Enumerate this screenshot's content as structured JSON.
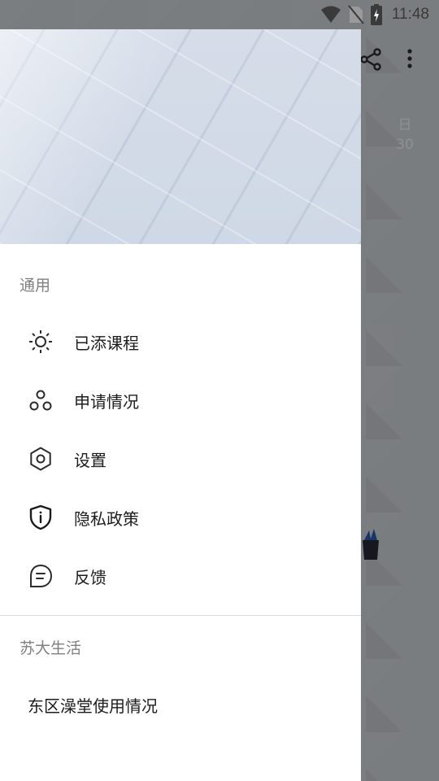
{
  "status_bar": {
    "time": "11:48",
    "icons": [
      "wifi-icon",
      "no-sim-icon",
      "battery-charging-icon"
    ]
  },
  "background_app": {
    "weekday_label": "日",
    "date_label": "30",
    "icons": [
      "share-icon",
      "more-vert-icon"
    ]
  },
  "drawer": {
    "sections": [
      {
        "title": "通用",
        "items": [
          {
            "label": "已添课程",
            "icon": "sun-icon"
          },
          {
            "label": "申请情况",
            "icon": "group-circles-icon"
          },
          {
            "label": "设置",
            "icon": "gear-icon"
          },
          {
            "label": "隐私政策",
            "icon": "shield-info-icon"
          },
          {
            "label": "反馈",
            "icon": "feedback-chat-icon"
          }
        ]
      },
      {
        "title": "苏大生活",
        "items": [
          {
            "label": "东区澡堂使用情况"
          }
        ]
      }
    ]
  },
  "colors": {
    "drawer_background": "#ffffff",
    "section_title": "#808080",
    "item_text": "#1c1c1c",
    "icon": "#2b2b2b"
  }
}
